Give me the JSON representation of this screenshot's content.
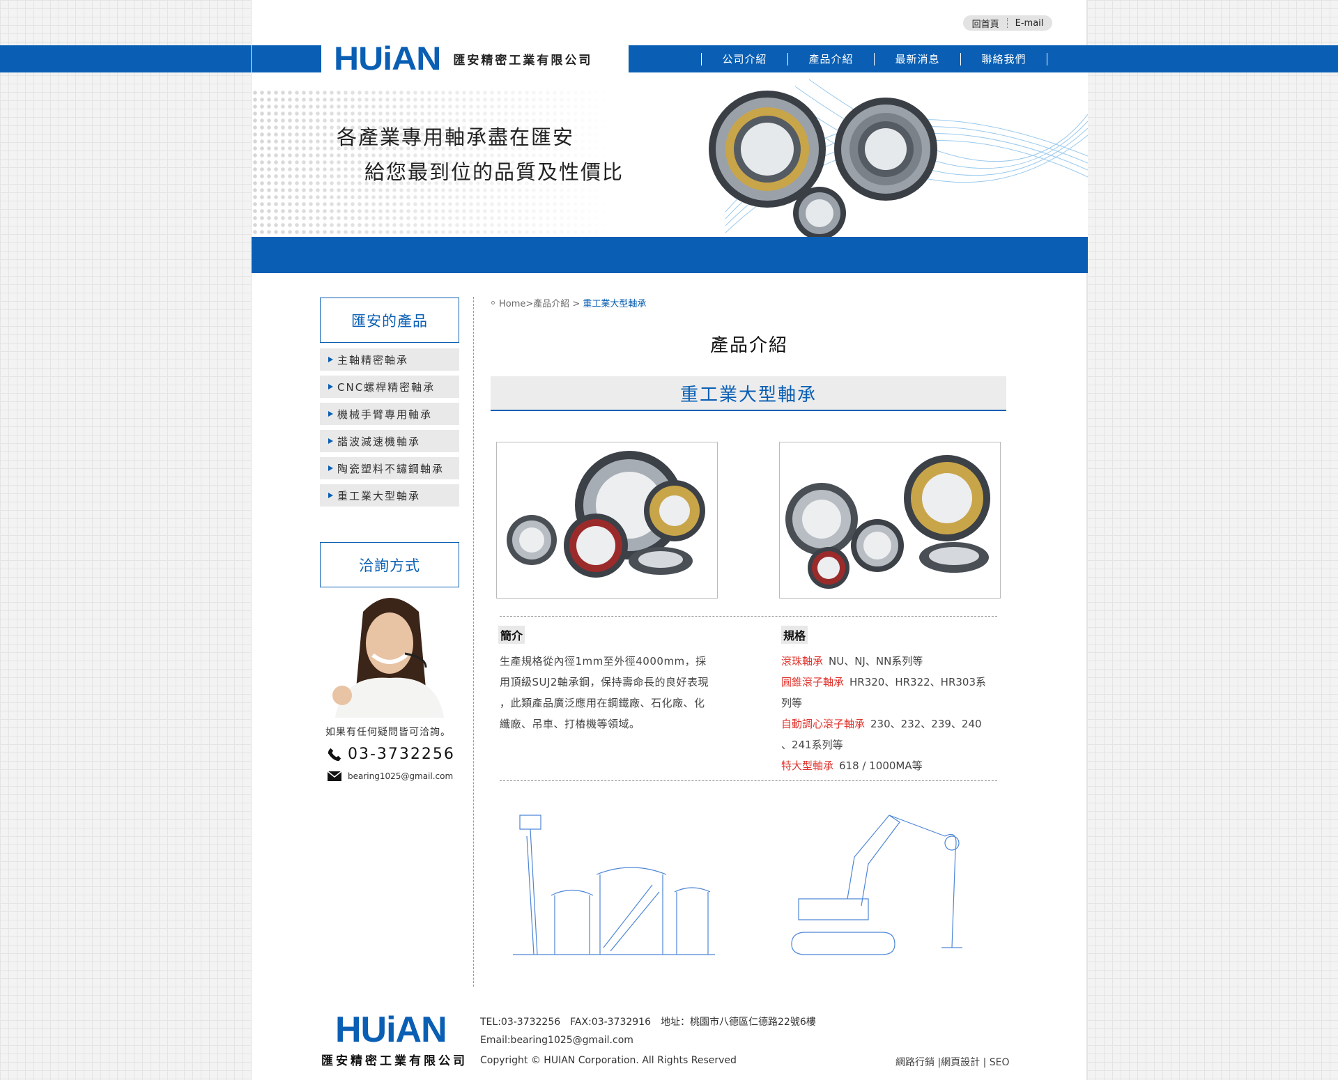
{
  "toplinks": {
    "home": "回首頁",
    "email": "E-mail"
  },
  "brand": {
    "logo": "HUiAN",
    "company": "匯安精密工業有限公司"
  },
  "nav": [
    "公司介紹",
    "產品介紹",
    "最新消息",
    "聯絡我們"
  ],
  "banner": {
    "line1": "各產業專用軸承盡在匯安",
    "line2": "給您最到位的品質及性價比"
  },
  "sidebar": {
    "products_title": "匯安的產品",
    "items": [
      "主軸精密軸承",
      "CNC螺桿精密軸承",
      "機械手臂專用軸承",
      "諧波減速機軸承",
      "陶瓷塑料不鏽鋼軸承",
      "重工業大型軸承"
    ],
    "contact_title": "洽詢方式",
    "contact_text": "如果有任何疑問皆可洽詢。",
    "phone": "03-3732256",
    "email": "bearing1025@gmail.com"
  },
  "breadcrumb": {
    "trail": "Home>產品介紹 >",
    "current": "重工業大型軸承"
  },
  "main": {
    "title": "產品介紹",
    "category": "重工業大型軸承",
    "intro_label": "簡介",
    "intro_lines": [
      "生產規格從內徑1mm至外徑4000mm，採",
      "用頂級SUJ2軸承鋼，保持壽命長的良好表現",
      "，此類產品廣泛應用在鋼鐵廠、石化廠、化",
      "纖廠、吊車、打樁機等領域。"
    ],
    "spec_label": "規格",
    "specs": [
      {
        "name": "滾珠軸承",
        "value": "NU、NJ、NN系列等"
      },
      {
        "name": "圓錐滾子軸承",
        "value": "HR320、HR322、HR303系",
        "cont": "列等"
      },
      {
        "name": "自動調心滾子軸承",
        "value": "230、232、239、240",
        "cont": "、241系列等"
      },
      {
        "name": "特大型軸承",
        "value": "618 / 1000MA等"
      }
    ]
  },
  "footer": {
    "logo": "HUiAN",
    "company": "匯安精密工業有限公司",
    "line1": "TEL:03-3732256　FAX:03-3732916　地址：桃園市八德區仁德路22號6樓",
    "line2": "Email:bearing1025@gmail.com",
    "line3": "Copyright © HUIAN Corporation. All Rights Reserved",
    "links": "網路行銷 |網頁設計 | SEO"
  },
  "colors": {
    "brand_blue": "#0a5fb4",
    "spec_red": "#e0342e"
  }
}
